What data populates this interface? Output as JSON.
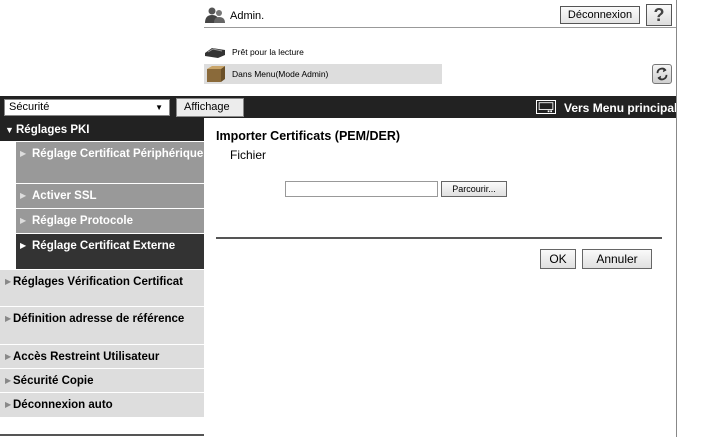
{
  "header": {
    "user_label": "Admin.",
    "logout_label": "Déconnexion",
    "help_label": "?",
    "status_ready": "Prêt pour la lecture",
    "status_mode": "Dans Menu(Mode Admin)"
  },
  "topbar": {
    "category_select": "Sécurité",
    "view_button": "Affichage",
    "main_menu_link": "Vers Menu principal"
  },
  "sidebar": {
    "items": [
      {
        "label": "Réglages PKI",
        "type": "head"
      },
      {
        "label": "Réglage Certificat Périphérique",
        "type": "sub"
      },
      {
        "label": "Activer SSL",
        "type": "sub"
      },
      {
        "label": "Réglage Protocole",
        "type": "sub"
      },
      {
        "label": "Réglage Certificat Externe",
        "type": "sub-active"
      },
      {
        "label": "Réglages Vérification Certificat",
        "type": "item"
      },
      {
        "label": "Définition adresse de référence",
        "type": "item"
      },
      {
        "label": "Accès Restreint Utilisateur",
        "type": "item"
      },
      {
        "label": "Sécurité Copie",
        "type": "item"
      },
      {
        "label": "Déconnexion auto",
        "type": "item"
      }
    ]
  },
  "main": {
    "title": "Importer Certificats (PEM/DER)",
    "file_label": "Fichier",
    "file_value": "",
    "browse_label": "Parcourir...",
    "ok_label": "OK",
    "cancel_label": "Annuler"
  },
  "colors": {
    "bar_dark": "#222222",
    "sidebar_light": "#dddddd",
    "sidebar_sub": "#999999",
    "sidebar_active": "#333333"
  },
  "icons": {
    "user": "admin-user-icon",
    "printer": "printer-icon",
    "box": "box-icon",
    "refresh": "refresh-icon",
    "menu": "menu-icon"
  }
}
